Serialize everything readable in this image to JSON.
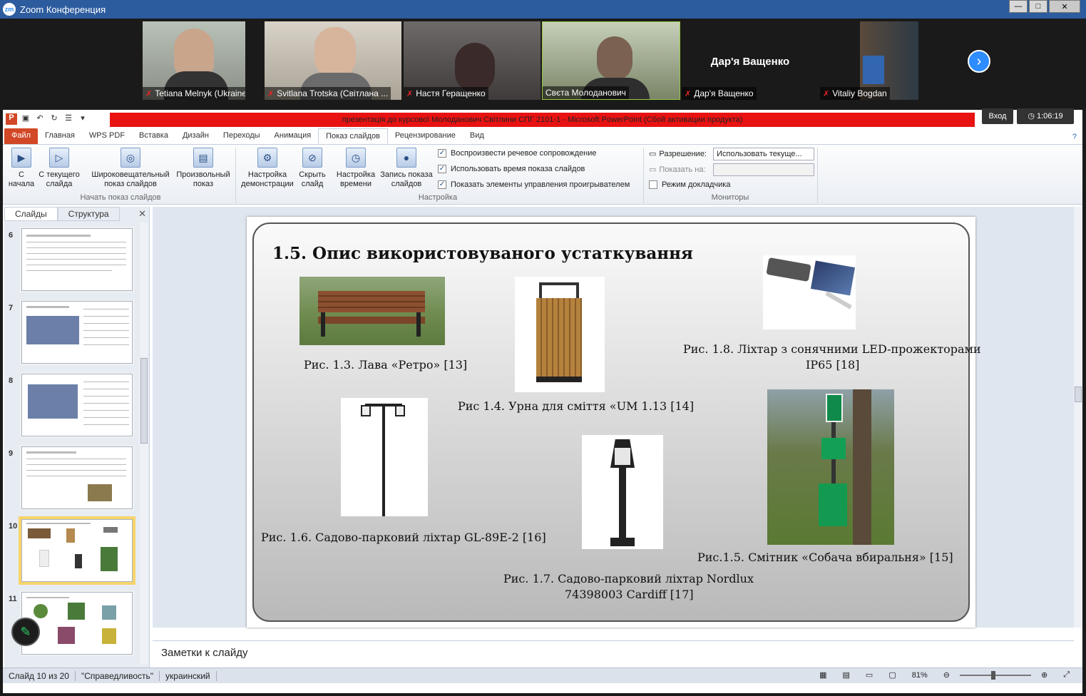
{
  "zoom": {
    "title": "Zoom Конференция",
    "logo": "zm",
    "window_buttons": [
      "—",
      "□",
      "✕"
    ],
    "participants": [
      {
        "name": "Tetiana Melnyk (Ukraine, S...",
        "muted": true
      },
      {
        "name": "Svitlana Trotska (Світлана ...",
        "muted": true
      },
      {
        "name": "Настя Геращенко",
        "muted": true
      },
      {
        "name": "Свєта Молоданович",
        "muted": false
      },
      {
        "name": "Дар'я Ващенко",
        "muted": true,
        "no_video_label": "Дар'я Ващенко"
      },
      {
        "name": "Vitaliy Bogdan",
        "muted": true
      }
    ],
    "next_icon": "›",
    "mute_icon": "✗"
  },
  "ppt": {
    "window_title": "презентація до курсової Молоданович Світлини СПГ 2101-1 - Microsoft PowerPoint (Сбой активации продукта)",
    "login_label": "Вход",
    "timer": "1:06:19",
    "tabs": [
      "Файл",
      "Главная",
      "WPS PDF",
      "Вставка",
      "Дизайн",
      "Переходы",
      "Анимация",
      "Показ слайдов",
      "Рецензирование",
      "Вид"
    ],
    "ribbon": {
      "btn_from_start": "С начала",
      "btn_from_current": "С текущего слайда",
      "btn_broadcast": "Широковещательный показ слайдов",
      "btn_custom": "Произвольный показ",
      "group_start": "Начать показ слайдов",
      "btn_setup": "Настройка демонстрации",
      "btn_hide": "Скрыть слайд",
      "btn_timing": "Настройка времени",
      "btn_record": "Запись показа слайдов",
      "chk_narration": "Воспроизвести речевое сопровождение",
      "chk_timings": "Использовать время показа слайдов",
      "chk_controls": "Показать элементы управления проигрывателем",
      "group_setup": "Настройка",
      "resolution_label": "Разрешение:",
      "resolution_value": "Использовать текуще...",
      "show_on_label": "Показать на:",
      "presenter_label": "Режим докладчика",
      "group_monitors": "Мониторы"
    },
    "panel": {
      "tab_slides": "Слайды",
      "tab_outline": "Структура",
      "close": "✕",
      "thumbnails": [
        "6",
        "7",
        "8",
        "9",
        "10",
        "11"
      ]
    },
    "slide": {
      "title": "1.5. Опис використовуваного устаткування",
      "captions": {
        "bench": "Рис. 1.3. Лава «Ретро» [13]",
        "urn": "Рис 1.4. Урна для сміття «UM 1.13 [14]",
        "led": "Рис. 1.8. Ліхтар з сонячними LED-прожекторами",
        "led2": "IP65 [18]",
        "lamp": "Рис. 1.6. Садово-парковий ліхтар GL-89E-2 [16]",
        "dogbin": "Рис.1.5. Смітник «Собача вбиральня» [15]",
        "nordlux": "Рис. 1.7.  Садово-парковий ліхтар Nordlux",
        "nordlux2": "74398003 Cardiff  [17]"
      }
    },
    "notes_placeholder": "Заметки к слайду",
    "status": {
      "slide": "Слайд 10 из 20",
      "theme": "\"Справедливость\"",
      "lang": "украинский",
      "zoom": "81%"
    }
  }
}
